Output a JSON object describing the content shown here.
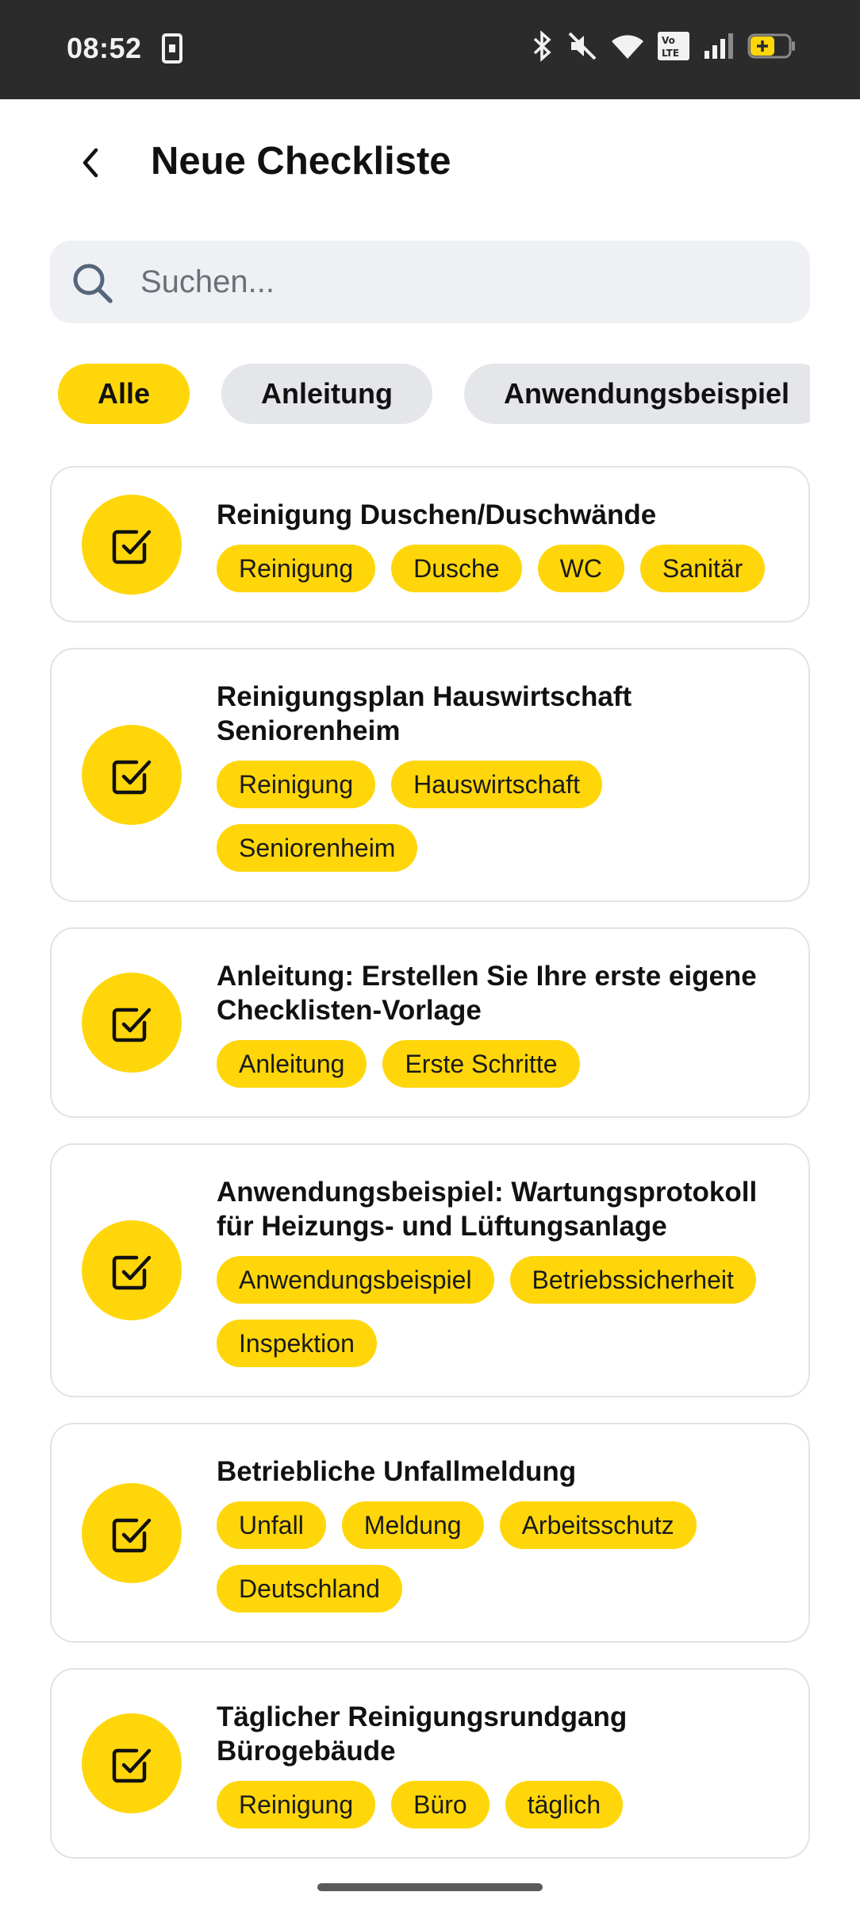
{
  "status_bar": {
    "time": "08:52",
    "icons": [
      "phone-icon",
      "bluetooth-icon",
      "mute-icon",
      "wifi-icon",
      "volte-icon",
      "signal-icon",
      "battery-icon"
    ],
    "volte_label": "Vo LTE"
  },
  "header": {
    "title": "Neue Checkliste",
    "back_icon": "chevron-left-icon"
  },
  "search": {
    "placeholder": "Suchen...",
    "value": ""
  },
  "filters": [
    {
      "label": "Alle",
      "active": true
    },
    {
      "label": "Anleitung",
      "active": false
    },
    {
      "label": "Anwendungsbeispiel",
      "active": false
    }
  ],
  "checklists": [
    {
      "title": "Reinigung Duschen/Duschwände",
      "tags": [
        "Reinigung",
        "Dusche",
        "WC",
        "Sanitär"
      ]
    },
    {
      "title": "Reinigungsplan Hauswirtschaft Seniorenheim",
      "tags": [
        "Reinigung",
        "Hauswirtschaft",
        "Seniorenheim"
      ]
    },
    {
      "title": "Anleitung: Erstellen Sie Ihre erste eigene Checklisten-Vorlage",
      "tags": [
        "Anleitung",
        "Erste Schritte"
      ]
    },
    {
      "title": "Anwendungsbeispiel: Wartungsprotokoll für Heizungs- und Lüftungsanlage",
      "tags": [
        "Anwendungsbeispiel",
        "Betriebssicherheit",
        "Inspektion"
      ]
    },
    {
      "title": "Betriebliche Unfallmeldung",
      "tags": [
        "Unfall",
        "Meldung",
        "Arbeitsschutz",
        "Deutschland"
      ]
    },
    {
      "title": "Täglicher Reinigungsrundgang Bürogebäude",
      "tags": [
        "Reinigung",
        "Büro",
        "täglich"
      ]
    }
  ],
  "colors": {
    "accent": "#ffd60a",
    "status_bar": "#2b2b2b",
    "chip_inactive": "#e4e6ea",
    "search_bg": "#eef0f3"
  }
}
